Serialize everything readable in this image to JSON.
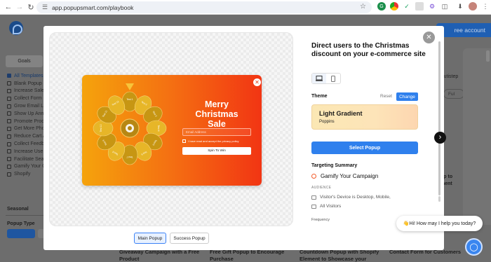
{
  "browser": {
    "url": "app.popupsmart.com/playbook",
    "back_icon": "arrow-left-icon",
    "forward_icon": "arrow-right-icon",
    "reload_icon": "reload-icon"
  },
  "background": {
    "create_button": "ree account",
    "goals_tab": "Goals",
    "sidebar_items": [
      "All Templates",
      "Blank Popup",
      "Increase Sale",
      "Collect Form S",
      "Grow Email Li",
      "Show Up Ann",
      "Promote Prod",
      "Get More Pho",
      "Reduce Cart A",
      "Collect Feedb",
      "Increase Use",
      "Facilitate Sea",
      "Gamify Your C",
      "Shopify"
    ],
    "seasonal_label": "Seasonal",
    "popup_type_label": "Popup Type",
    "right_autistep": "Autistep",
    "right_filter": "Ful",
    "right_card_text": [
      "up to",
      "ment"
    ],
    "bottom_cards": [
      [
        "Giveaway Campaign with a Free",
        "Product"
      ],
      [
        "Free Gift Popup to Encourage",
        "Purchase"
      ],
      [
        "Countdown Popup with Shopify",
        "Element to Showcase your"
      ],
      [
        "Contact Form for Customers"
      ]
    ]
  },
  "modal": {
    "title": "Direct users to the Christmas discount on your e-commerce site",
    "theme_label": "Theme",
    "reset_label": "Reset",
    "change_label": "Change",
    "theme_name": "Light Gradient",
    "theme_font": "Poppins",
    "select_button": "Select Popup",
    "targeting_title": "Targeting Summary",
    "targeting_item": "Gamify Your Campaign",
    "audience_label": "AUDIENCE",
    "audience_items": [
      "Visitor's Device is Desktop, Mobile,",
      "All Visitors"
    ],
    "frequency_label": "Frequency",
    "tab_main": "Main Popup",
    "tab_success": "Success Popup"
  },
  "popup": {
    "title": "Merry Christmas Sale",
    "email_placeholder": "Email Address",
    "consent_text": "I have read and accept the privacy policy",
    "spin_button": "Spin To Win",
    "wheel_labels": [
      "Test 1",
      "Test 2",
      "Test 3",
      "Test 4",
      "Test 5",
      "Test 6",
      "Test 7",
      "Test 8",
      "Test 9",
      "Test 10",
      "Test 11",
      "Test 12"
    ]
  },
  "chat": {
    "message": "👋Hi! How may I help you today?"
  },
  "colors": {
    "accent": "#2f80ed",
    "popup_gradient_start": "#f5a30c",
    "popup_gradient_end": "#f23513"
  }
}
